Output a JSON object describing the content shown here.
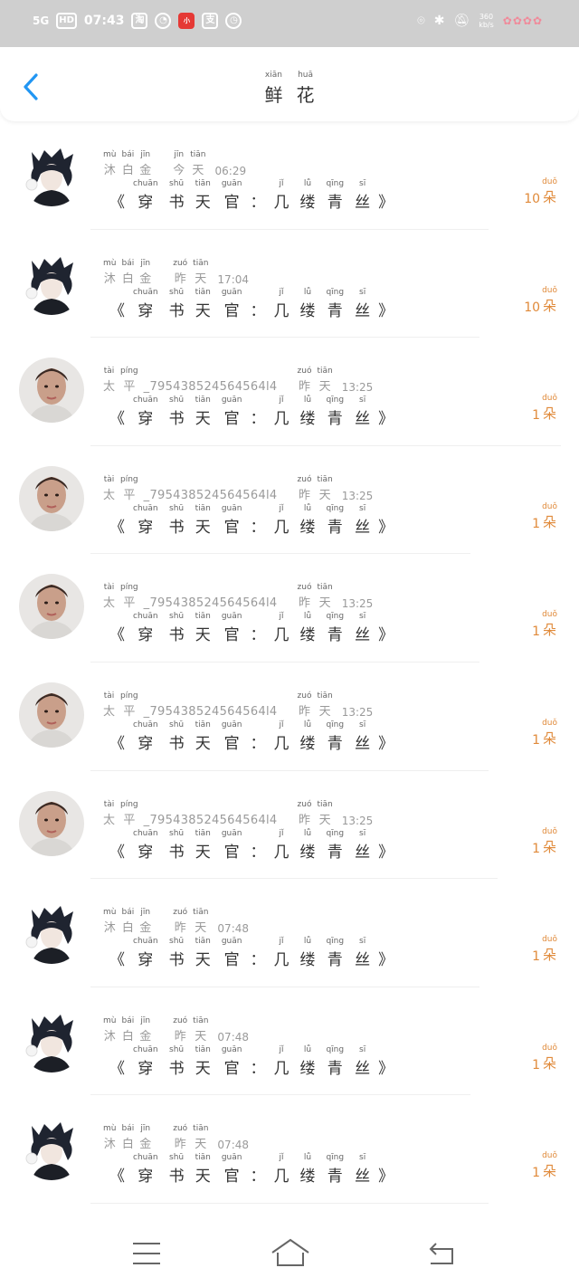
{
  "status_bar": {
    "signal": "5G",
    "hd": "HD",
    "time": "07:43",
    "app_icons": [
      "淘",
      "小"
    ],
    "speed_value": "360",
    "speed_unit": "kb/s"
  },
  "header": {
    "back_icon": "chevron-left-icon",
    "title": [
      {
        "hz": "鲜",
        "py": "xiān"
      },
      {
        "hz": "花",
        "py": "huā"
      }
    ]
  },
  "accent_color": "#e08a3a",
  "back_color": "#2196f3",
  "items": [
    {
      "avatar": "avatar-a",
      "name": [
        {
          "hz": "沐",
          "py": "mù"
        },
        {
          "hz": "白",
          "py": "bái"
        },
        {
          "hz": "金",
          "py": "jīn"
        }
      ],
      "day": [
        {
          "hz": "今",
          "py": "jīn"
        },
        {
          "hz": "天",
          "py": "tiān"
        }
      ],
      "time": "06:29",
      "count": "10"
    },
    {
      "avatar": "avatar-a",
      "name": [
        {
          "hz": "沐",
          "py": "mù"
        },
        {
          "hz": "白",
          "py": "bái"
        },
        {
          "hz": "金",
          "py": "jīn"
        }
      ],
      "day": [
        {
          "hz": "昨",
          "py": "zuó"
        },
        {
          "hz": "天",
          "py": "tiān"
        }
      ],
      "time": "17:04",
      "count": "10"
    },
    {
      "avatar": "avatar-b",
      "name": [
        {
          "hz": "太",
          "py": "tài"
        },
        {
          "hz": "平",
          "py": "píng"
        }
      ],
      "uname_suffix": "_795438524564564l4",
      "day": [
        {
          "hz": "昨",
          "py": "zuó"
        },
        {
          "hz": "天",
          "py": "tiān"
        }
      ],
      "time": "13:25",
      "count": "1"
    },
    {
      "avatar": "avatar-b",
      "name": [
        {
          "hz": "太",
          "py": "tài"
        },
        {
          "hz": "平",
          "py": "píng"
        }
      ],
      "uname_suffix": "_795438524564564l4",
      "day": [
        {
          "hz": "昨",
          "py": "zuó"
        },
        {
          "hz": "天",
          "py": "tiān"
        }
      ],
      "time": "13:25",
      "count": "1"
    },
    {
      "avatar": "avatar-b",
      "name": [
        {
          "hz": "太",
          "py": "tài"
        },
        {
          "hz": "平",
          "py": "píng"
        }
      ],
      "uname_suffix": "_795438524564564l4",
      "day": [
        {
          "hz": "昨",
          "py": "zuó"
        },
        {
          "hz": "天",
          "py": "tiān"
        }
      ],
      "time": "13:25",
      "count": "1"
    },
    {
      "avatar": "avatar-b",
      "name": [
        {
          "hz": "太",
          "py": "tài"
        },
        {
          "hz": "平",
          "py": "píng"
        }
      ],
      "uname_suffix": "_795438524564564l4",
      "day": [
        {
          "hz": "昨",
          "py": "zuó"
        },
        {
          "hz": "天",
          "py": "tiān"
        }
      ],
      "time": "13:25",
      "count": "1"
    },
    {
      "avatar": "avatar-b",
      "name": [
        {
          "hz": "太",
          "py": "tài"
        },
        {
          "hz": "平",
          "py": "píng"
        }
      ],
      "uname_suffix": "_795438524564564l4",
      "day": [
        {
          "hz": "昨",
          "py": "zuó"
        },
        {
          "hz": "天",
          "py": "tiān"
        }
      ],
      "time": "13:25",
      "count": "1"
    },
    {
      "avatar": "avatar-a",
      "name": [
        {
          "hz": "沐",
          "py": "mù"
        },
        {
          "hz": "白",
          "py": "bái"
        },
        {
          "hz": "金",
          "py": "jīn"
        }
      ],
      "day": [
        {
          "hz": "昨",
          "py": "zuó"
        },
        {
          "hz": "天",
          "py": "tiān"
        }
      ],
      "time": "07:48",
      "count": "1"
    },
    {
      "avatar": "avatar-a",
      "name": [
        {
          "hz": "沐",
          "py": "mù"
        },
        {
          "hz": "白",
          "py": "bái"
        },
        {
          "hz": "金",
          "py": "jīn"
        }
      ],
      "day": [
        {
          "hz": "昨",
          "py": "zuó"
        },
        {
          "hz": "天",
          "py": "tiān"
        }
      ],
      "time": "07:48",
      "count": "1"
    },
    {
      "avatar": "avatar-a",
      "name": [
        {
          "hz": "沐",
          "py": "mù"
        },
        {
          "hz": "白",
          "py": "bái"
        },
        {
          "hz": "金",
          "py": "jīn"
        }
      ],
      "day": [
        {
          "hz": "昨",
          "py": "zuó"
        },
        {
          "hz": "天",
          "py": "tiān"
        }
      ],
      "time": "07:48",
      "count": "1"
    }
  ],
  "book": {
    "open": "《",
    "close": "》",
    "sep": "：",
    "title_a": [
      {
        "hz": "穿",
        "py": "chuān"
      },
      {
        "hz": "书",
        "py": "shū"
      },
      {
        "hz": "天",
        "py": "tiān"
      },
      {
        "hz": "官",
        "py": "guān"
      }
    ],
    "title_b": [
      {
        "hz": "几",
        "py": "jǐ"
      },
      {
        "hz": "缕",
        "py": "lǚ"
      },
      {
        "hz": "青",
        "py": "qīng"
      },
      {
        "hz": "丝",
        "py": "sī"
      }
    ]
  },
  "flower_unit": {
    "hz": "朵",
    "py": "duǒ"
  },
  "nav_bar": {
    "menu_icon": "menu-icon",
    "home_icon": "home-icon",
    "back_icon": "back-arrow-icon"
  }
}
